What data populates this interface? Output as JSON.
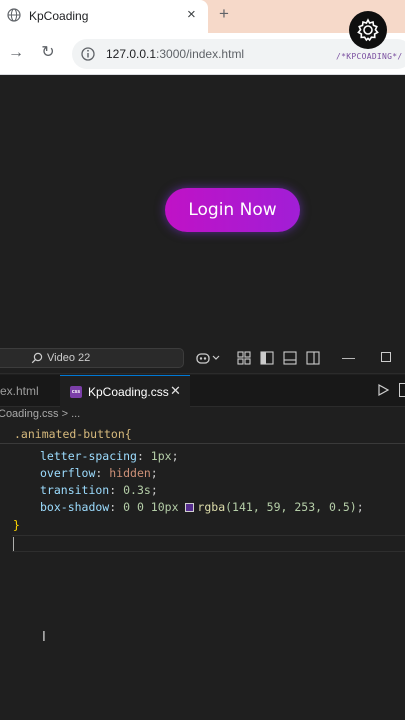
{
  "browser": {
    "tab_title": "KpCoading",
    "tab_close": "×",
    "new_tab": "+",
    "url_host": "127.0.0.1",
    "url_rest": ":3000/index.html",
    "watermark": "/*KPCOADING*/"
  },
  "viewport": {
    "login_button": "Login Now",
    "button_gradient": [
      "#c012c6",
      "#a11ed6"
    ]
  },
  "vscode": {
    "command_center": "Video 22",
    "tabs": [
      {
        "label": "ex.html",
        "active": false
      },
      {
        "label": "KpCoading.css",
        "active": true,
        "badge": "css"
      }
    ],
    "breadcrumb": "Coading.css > ...",
    "sticky_scroll": ".animated-button{",
    "code": [
      {
        "prop": "letter-spacing",
        "value": "1px"
      },
      {
        "prop": "overflow",
        "value": "hidden"
      },
      {
        "prop": "transition",
        "value": "0.3s"
      },
      {
        "prop": "box-shadow",
        "value_prefix": "0 0 10px ",
        "fn": "rgba",
        "args": "(141, 59, 253, 0.5)"
      }
    ],
    "closing_brace": "}"
  },
  "colors": {
    "editor_bg": "#1f1f1f",
    "accent": "#8d3bfd",
    "tabstrip": "#f6d9c9"
  }
}
